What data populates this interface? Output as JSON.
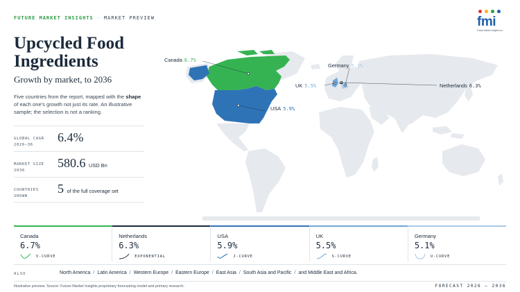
{
  "header": {
    "brand": "FUTURE MARKET INSIGHTS",
    "separator": "·",
    "crumb": "MARKET PREVIEW"
  },
  "logo": {
    "word": "fmi",
    "tagline": "Future Market Insights Inc.",
    "dot_colors": [
      "#e8312f",
      "#f6b512",
      "#2e9d44",
      "#1e5fa8"
    ]
  },
  "title": "Upcycled Food Ingredients",
  "subtitle": "Growth by market, to 2036",
  "description": {
    "part1": "Five countries from the report, mapped with the ",
    "bold": "shape",
    "part2": " of each one's growth not just its rate. An illustrative sample; the selection is not a ranking."
  },
  "stats": [
    {
      "label": "GLOBAL CAGR 2026–36",
      "value": "6.4%",
      "unit": ""
    },
    {
      "label": "MARKET SIZE 2036",
      "value": "580.6",
      "unit": "USD Bn"
    },
    {
      "label": "COUNTRIES SHOWN",
      "value": "5",
      "unit": "of the full coverage set"
    }
  ],
  "map_labels": [
    {
      "name": "Canada",
      "pct": "6.7%"
    },
    {
      "name": "Germany",
      "pct": "5.1%"
    },
    {
      "name": "UK",
      "pct": "5.5%"
    },
    {
      "name": "Netherlands",
      "pct": "6.3%"
    },
    {
      "name": "USA",
      "pct": "5.9%"
    }
  ],
  "colors": {
    "green": "#35b352",
    "navy": "#1b2a3a",
    "blue": "#2f73b7",
    "light_blue": "#6ea6d8",
    "pale_blue": "#a8c8e8",
    "land": "#e6e9ed"
  },
  "cards": [
    {
      "country": "Canada",
      "value": "6.7%",
      "curve": "V-CURVE",
      "icon": "v-curve-icon",
      "color": "#35b352"
    },
    {
      "country": "Netherlands",
      "value": "6.3%",
      "curve": "EXPONENTIAL",
      "icon": "exponential-curve-icon",
      "color": "#1b2a3a"
    },
    {
      "country": "USA",
      "value": "5.9%",
      "curve": "J-CURVE",
      "icon": "j-curve-icon",
      "color": "#2f73b7"
    },
    {
      "country": "UK",
      "value": "5.5%",
      "curve": "S-CURVE",
      "icon": "s-curve-icon",
      "color": "#6ea6d8"
    },
    {
      "country": "Germany",
      "value": "5.1%",
      "curve": "U-CURVE",
      "icon": "u-curve-icon",
      "color": "#a8c8e8"
    }
  ],
  "also": {
    "label": "ALSO",
    "regions": [
      "North America",
      "Latin America",
      "Western Europe",
      "Eastern Europe",
      "East Asia",
      "South Asia and Pacific",
      "and Middle East and Africa."
    ]
  },
  "footer": {
    "source": "Illustrative preview. Source: Future Market Insights proprietary forecasting model and primary research.",
    "forecast": "FORECAST 2026 – 2036"
  }
}
